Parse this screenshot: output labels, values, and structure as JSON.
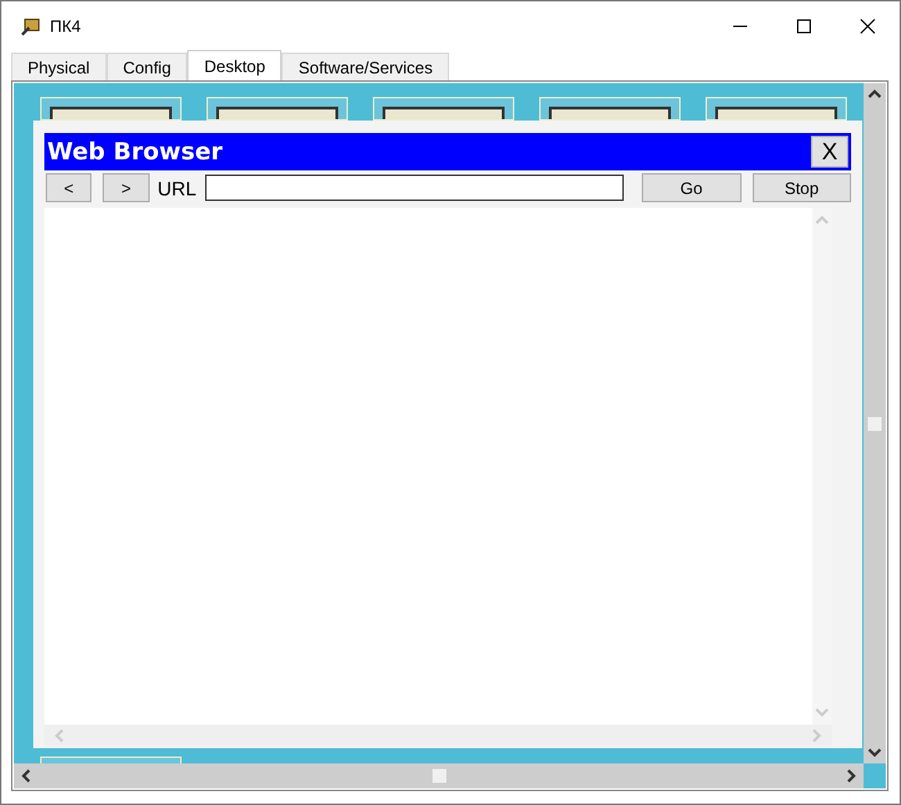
{
  "window": {
    "title": "ПК4"
  },
  "tabs": [
    {
      "label": "Physical",
      "selected": false
    },
    {
      "label": "Config",
      "selected": false
    },
    {
      "label": "Desktop",
      "selected": true
    },
    {
      "label": "Software/Services",
      "selected": false
    }
  ],
  "browser": {
    "title": "Web Browser",
    "close": "X",
    "back": "<",
    "forward": ">",
    "url_label": "URL",
    "go": "Go",
    "stop": "Stop"
  }
}
